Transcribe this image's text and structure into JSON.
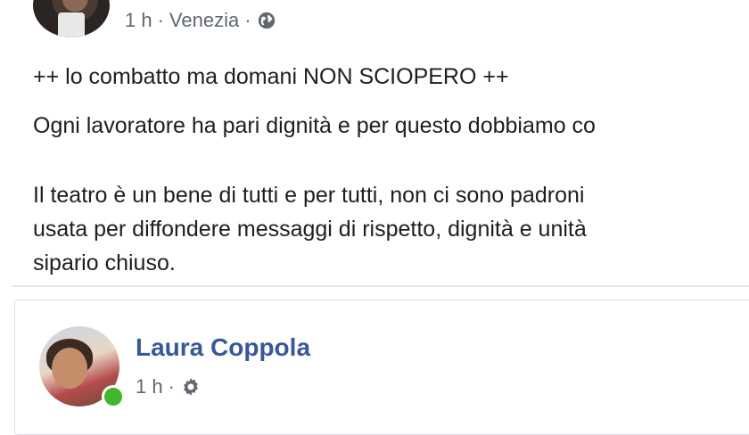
{
  "post": {
    "time": "1 h",
    "sep1": "·",
    "location": "Venezia",
    "sep2": "·",
    "privacy_icon": "globe-icon",
    "paragraphs": [
      "++ lo combatto ma domani NON SCIOPERO ++",
      "Ogni lavoratore ha pari dignità e per questo dobbiamo co",
      "Il teatro è un bene di tutti e per tutti, non ci sono padroni",
      "usata per diffondere messaggi di rispetto, dignità e unità",
      "sipario chiuso."
    ]
  },
  "comment_card": {
    "author": "Laura Coppola",
    "time": "1 h",
    "sep": "·",
    "privacy_icon": "gear-icon",
    "status": "online",
    "colors": {
      "author": "#385898",
      "online": "#42b72a"
    }
  }
}
